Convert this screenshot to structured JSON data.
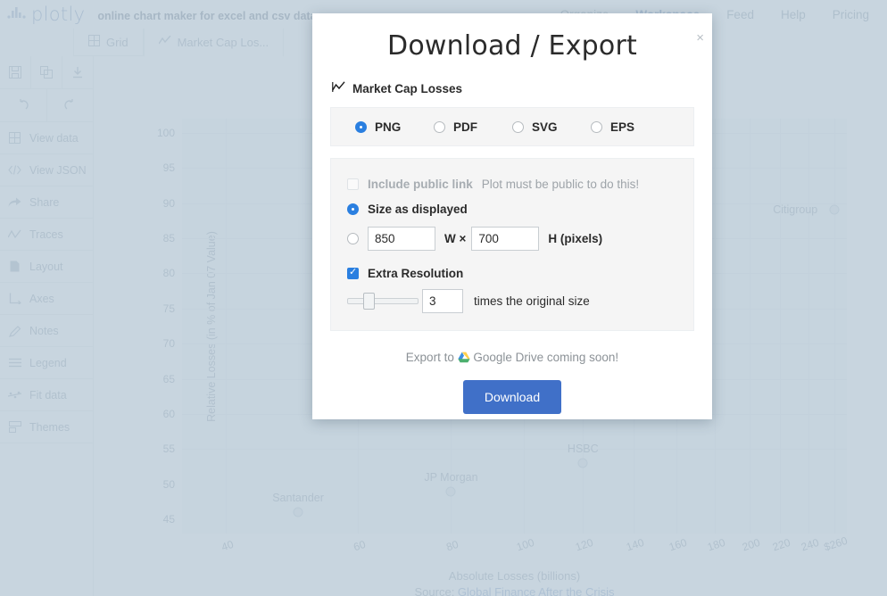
{
  "nav": {
    "brand": "plotly",
    "tagline": "online chart maker for excel and csv data",
    "links": [
      {
        "label": "Organize",
        "active": false
      },
      {
        "label": "Workspace",
        "active": true
      },
      {
        "label": "Feed",
        "active": false
      },
      {
        "label": "Help",
        "active": false
      },
      {
        "label": "Pricing",
        "active": false
      }
    ]
  },
  "tabs": [
    {
      "label": "Grid",
      "icon": "grid-icon"
    },
    {
      "label": "Market Cap Los...",
      "icon": "line-chart-icon"
    }
  ],
  "sidebar": {
    "tool_icons": [
      {
        "name": "save-icon"
      },
      {
        "name": "copy-icon"
      },
      {
        "name": "download-icon"
      },
      {
        "name": "undo-icon"
      },
      {
        "name": "redo-icon"
      }
    ],
    "items": [
      {
        "label": "View data",
        "icon": "grid-icon"
      },
      {
        "label": "View JSON",
        "icon": "code-icon"
      },
      {
        "label": "Share",
        "icon": "share-icon"
      },
      {
        "label": "Traces",
        "icon": "traces-icon"
      },
      {
        "label": "Layout",
        "icon": "layout-icon"
      },
      {
        "label": "Axes",
        "icon": "axes-icon"
      },
      {
        "label": "Notes",
        "icon": "pencil-icon"
      },
      {
        "label": "Legend",
        "icon": "legend-icon"
      },
      {
        "label": "Fit data",
        "icon": "fit-data-icon"
      },
      {
        "label": "Themes",
        "icon": "themes-icon"
      }
    ]
  },
  "chart_data": {
    "type": "scatter",
    "title": "Market Cap Losses",
    "xlabel": "Absolute Losses (billions)",
    "ylabel": "Relative Losses (in % of Jan 07 Value)",
    "source_prefix": "Source: ",
    "source_link": "Global Finance After the Crisis",
    "xscale": "log",
    "xticks": [
      "40",
      "60",
      "80",
      "100",
      "120",
      "140",
      "160",
      "180",
      "200",
      "220",
      "240",
      "$260"
    ],
    "yticks": [
      "100",
      "95",
      "90",
      "85",
      "80",
      "75",
      "70",
      "65",
      "60",
      "55",
      "50",
      "45"
    ],
    "ylim": [
      43,
      102
    ],
    "grid": true,
    "legend": "none",
    "points": [
      {
        "label": "Citigroup",
        "x": 260,
        "y": 89
      },
      {
        "label": "HSBC",
        "x": 120,
        "y": 53
      },
      {
        "label": "JP Morgan",
        "x": 80,
        "y": 49
      },
      {
        "label": "Santander",
        "x": 50,
        "y": 46
      }
    ]
  },
  "modal": {
    "title": "Download / Export",
    "close_label": "×",
    "chart_name": "Market Cap Losses",
    "formats": [
      {
        "label": "PNG",
        "selected": true
      },
      {
        "label": "PDF",
        "selected": false
      },
      {
        "label": "SVG",
        "selected": false
      },
      {
        "label": "EPS",
        "selected": false
      }
    ],
    "public_link": {
      "label": "Include public link",
      "hint": "Plot must be public to do this!",
      "checked": false,
      "disabled": true
    },
    "size_as_displayed": {
      "label": "Size as displayed",
      "selected": true
    },
    "custom_size": {
      "selected": false,
      "width": "850",
      "height": "700",
      "w_label": "W ×",
      "h_label": "H (pixels)"
    },
    "extra_resolution": {
      "label": "Extra Resolution",
      "checked": true,
      "multiplier": "3",
      "suffix": "times the original size",
      "slider_percent": 22
    },
    "gdrive_prefix": "Export to ",
    "gdrive_text": "Google Drive coming soon!",
    "download_label": "Download"
  },
  "colors": {
    "accent_blue": "#2a7fe0",
    "button_blue": "#4070c8",
    "overlay": "#bacbd7",
    "muted_text": "#8b9aa8"
  }
}
